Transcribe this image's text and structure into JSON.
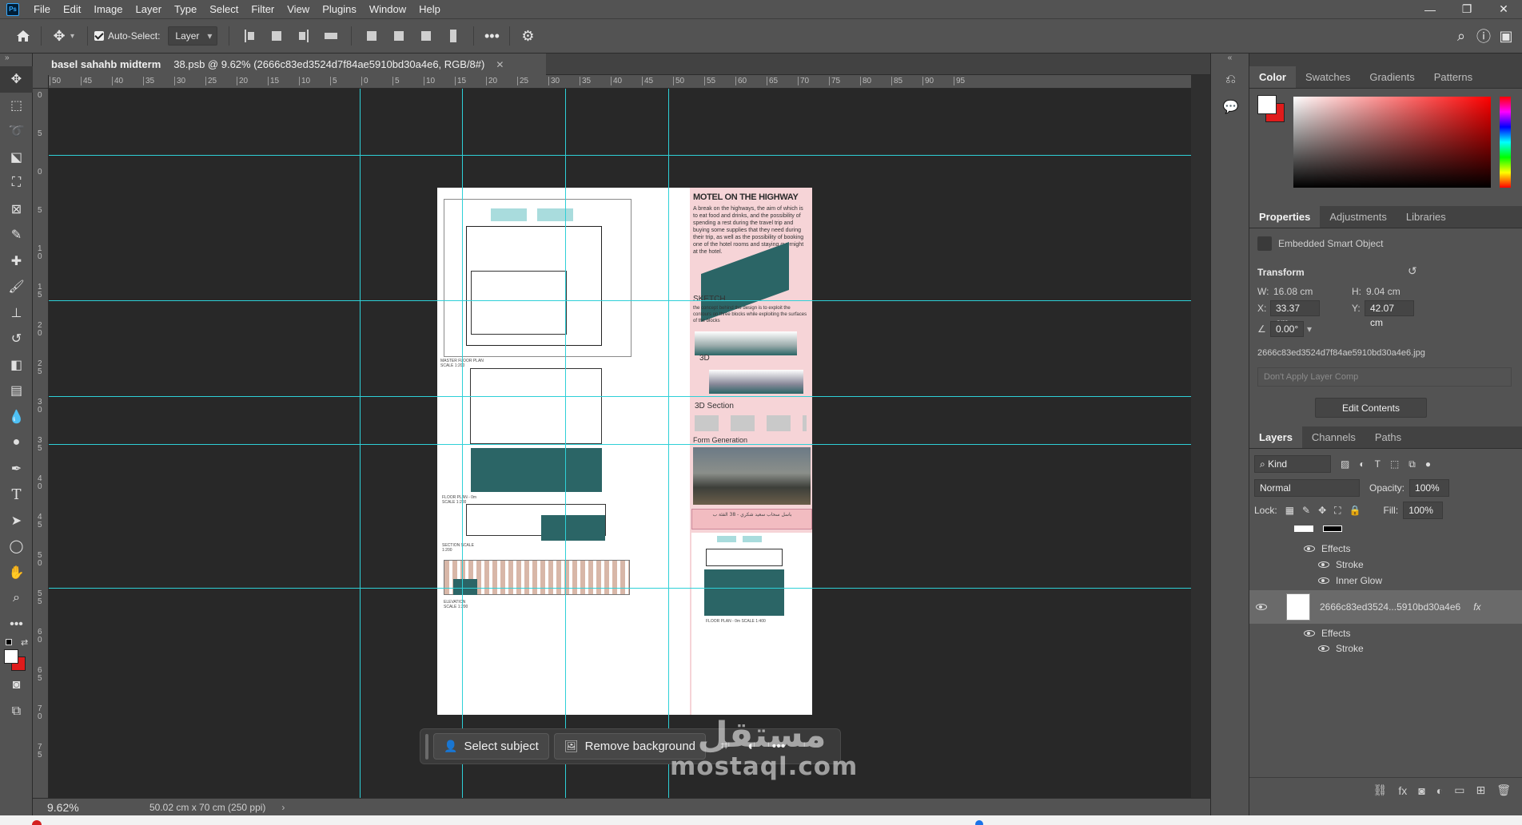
{
  "menu": [
    "File",
    "Edit",
    "Image",
    "Layer",
    "Type",
    "Select",
    "Filter",
    "View",
    "Plugins",
    "Window",
    "Help"
  ],
  "app_logo": "Ps",
  "window_controls": {
    "minimize": "—",
    "restore": "❐",
    "close": "✕"
  },
  "options_bar": {
    "auto_select_label": "Auto-Select:",
    "auto_select_checked": true,
    "target": "Layer"
  },
  "document": {
    "project": "basel sahahb midterm",
    "title": "38.psb @ 9.62% (2666c83ed3524d7f84ae5910bd30a4e6, RGB/8#)",
    "close": "✕"
  },
  "rulers": {
    "h_labels": [
      "50",
      "45",
      "40",
      "35",
      "30",
      "25",
      "20",
      "15",
      "10",
      "5",
      "0",
      "5",
      "10",
      "15",
      "20",
      "25",
      "30",
      "35",
      "40",
      "45",
      "50",
      "55",
      "60",
      "65",
      "70",
      "75",
      "80",
      "85",
      "90",
      "95"
    ],
    "v_labels": [
      "0",
      "5",
      "0",
      "5",
      "1 0",
      "1 5",
      "2 0",
      "2 5",
      "3 0",
      "3 5",
      "4 0",
      "4 5",
      "5 0",
      "5 5",
      "6 0",
      "6 5",
      "7 0",
      "7 5"
    ]
  },
  "artboard": {
    "title": "MOTEL ON THE HIGHWAY",
    "intro": "A break on the highways, the aim of which is to eat food and drinks, and the possibility of spending a rest during the travel trip and buying some supplies that they need during their trip, as well as the possibility of booking one of the hotel rooms and staying overnight at the hotel.",
    "sketch_label": "SKETCH",
    "sketch_text": "the concept behind the design is to exploit the contours on three blocks while exploiting the surfaces of the blocks",
    "label_3d": "3D",
    "label_3d_section": "3D Section",
    "label_form": "Form Generation",
    "plan_master": "MASTER FLOOR PLAN SCALE 1:200",
    "plan_floor": "FLOOR PLAN - 0m SCALE 1:200",
    "plan_section": "SECTION SCALE 1:200",
    "plan_elevation": "ELEVATION SCALE 1:200",
    "author_credit": "باسل سحاب سعيد شكري - 38 الفئة ب",
    "floor_plan_small": "FLOOR PLAN - 0m SCALE 1:400"
  },
  "context_bar": {
    "select_subject": "Select subject",
    "remove_background": "Remove background",
    "more": "•••"
  },
  "status": {
    "zoom": "9.62%",
    "doc_size": "50.02 cm x 70 cm (250 ppi)"
  },
  "panels": {
    "color_tabs": [
      "Color",
      "Swatches",
      "Gradients",
      "Patterns"
    ],
    "properties_tabs": [
      "Properties",
      "Adjustments",
      "Libraries"
    ],
    "smart_object": "Embedded Smart Object",
    "transform_label": "Transform",
    "w_label": "W:",
    "w": "16.08 cm",
    "h_label": "H:",
    "h": "9.04 cm",
    "x_label": "X:",
    "x": "33.37 cm",
    "y_label": "Y:",
    "y": "42.07 cm",
    "angle": "0.00°",
    "filename": "2666c83ed3524d7f84ae5910bd30a4e6.jpg",
    "layer_comp": "Don't Apply Layer Comp",
    "edit_contents": "Edit Contents",
    "layers_tabs": [
      "Layers",
      "Channels",
      "Paths"
    ],
    "kind": "Kind",
    "blend_mode": "Normal",
    "opacity_label": "Opacity:",
    "opacity": "100%",
    "lock_label": "Lock:",
    "fill_label": "Fill:",
    "fill": "100%",
    "effects": "Effects",
    "stroke": "Stroke",
    "inner_glow": "Inner Glow",
    "layer_name": "2666c83ed3524...5910bd30a4e6",
    "fx": "fx"
  },
  "watermark": {
    "arabic": "مستقل",
    "latin": "mostaql.com"
  },
  "colors": {
    "guide": "#2ed0d7",
    "accent_teal": "#2b6566",
    "accent_pink": "#f6d4d7",
    "fg": "#ffffff",
    "bg": "#e01b1b"
  }
}
